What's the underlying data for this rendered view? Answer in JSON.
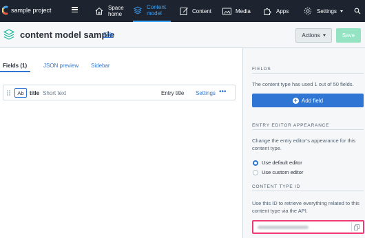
{
  "topnav": {
    "space_name": "sample project",
    "items": [
      {
        "label_line1": "Space",
        "label_line2": "home",
        "icon": "home-icon"
      },
      {
        "label_line1": "Content",
        "label_line2": "model",
        "icon": "content-model-icon",
        "active": true
      },
      {
        "label": "Content",
        "icon": "content-icon"
      },
      {
        "label": "Media",
        "icon": "media-icon"
      },
      {
        "label": "Apps",
        "icon": "apps-icon"
      },
      {
        "label": "Settings",
        "icon": "gear-icon"
      }
    ],
    "active_color": "#3ea7ff",
    "bg_color": "#1d2430"
  },
  "header": {
    "title": "content model sample",
    "edit_label": "Edit",
    "actions_label": "Actions",
    "save_label": "Save"
  },
  "tabs": [
    {
      "label": "Fields (1)",
      "active": true
    },
    {
      "label": "JSON preview"
    },
    {
      "label": "Sidebar"
    }
  ],
  "fields": [
    {
      "badge": "Ab",
      "name": "title",
      "type": "Short text",
      "entry_title_label": "Entry title",
      "settings_label": "Settings",
      "more_label": "•••"
    }
  ],
  "sidebar": {
    "fields_title": "FIELDS",
    "fields_text": "The content type has used 1 out of 50 fields.",
    "add_field_label": "Add field",
    "appearance_title": "ENTRY EDITOR APPEARANCE",
    "appearance_text": "Change the entry editor’s appearance for this content type.",
    "radio_default": "Use default editor",
    "radio_custom": "Use custom editor",
    "id_title": "CONTENT TYPE ID",
    "id_text": "Use this ID to retrieve everything related to this content type via the API."
  },
  "colors": {
    "accent": "#2e75d4",
    "save_disabled": "#94e3c3",
    "highlight": "#ef3a74"
  }
}
